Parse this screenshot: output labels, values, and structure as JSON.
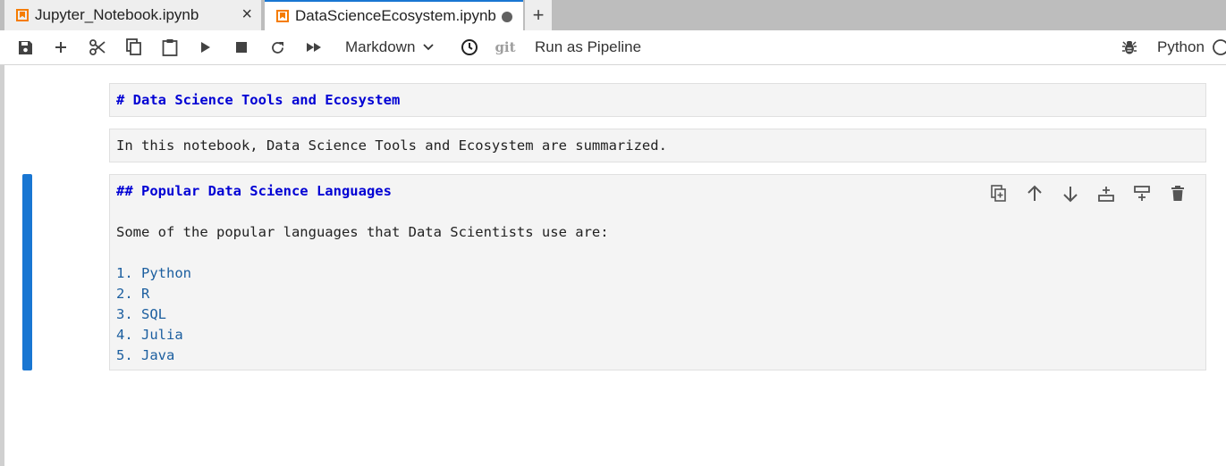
{
  "tabs": [
    {
      "label": "Jupyter_Notebook.ipynb",
      "active": false,
      "close": "×"
    },
    {
      "label": "DataScienceEcosystem.ipynb",
      "active": true,
      "modified": true
    }
  ],
  "tab_add": "+",
  "toolbar": {
    "cell_type": "Markdown",
    "git_label": "git",
    "pipeline_label": "Run as Pipeline",
    "kernel_name": "Python"
  },
  "cells": [
    {
      "type": "markdown",
      "lines": [
        "# Data Science Tools and Ecosystem"
      ]
    },
    {
      "type": "markdown",
      "lines": [
        "In this notebook, Data Science Tools and Ecosystem are summarized."
      ]
    },
    {
      "type": "markdown",
      "active": true,
      "lines": [
        "## Popular Data Science Languages",
        "Some of the popular languages that Data Scientists use are:",
        "1. Python",
        "2. R",
        "3. SQL",
        "4. Julia",
        "5. Java"
      ]
    }
  ],
  "colors": {
    "accent": "#1976d2",
    "notebook_icon": "#f57c00",
    "markdown_header": "#0000d4",
    "list_item": "#1b5e9f"
  }
}
